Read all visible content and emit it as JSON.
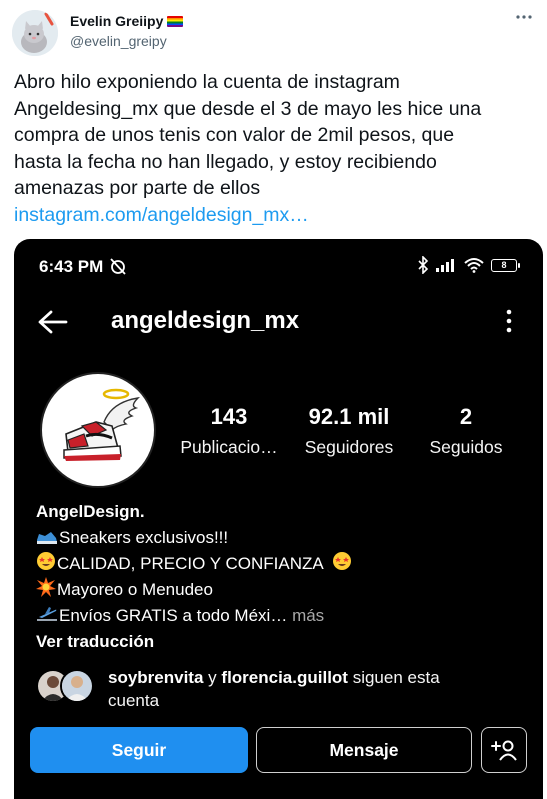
{
  "tweet": {
    "author_name": "Evelin Greiipy",
    "author_handle": "@evelin_greipy",
    "more_icon": "more-horizontal-icon",
    "text_lines": [
      "Abro hilo exponiendo la cuenta de instagram",
      "Angeldesing_mx que desde el 3 de mayo les hice una",
      "compra de unos tenis con valor de 2mil pesos, que",
      "hasta la fecha no han llegado, y estoy recibiendo",
      "amenazas por parte de ellos"
    ],
    "link_text": "instagram.com/angeldesign_mx…",
    "link_color": "#1d9bf0"
  },
  "instagram": {
    "status_bar": {
      "time": "6:43 PM",
      "battery": "8"
    },
    "username": "angeldesign_mx",
    "stats": [
      {
        "value": "143",
        "label": "Publicacio…"
      },
      {
        "value": "92.1 mil",
        "label": "Seguidores"
      },
      {
        "value": "2",
        "label": "Seguidos"
      }
    ],
    "bio": {
      "name": "AngelDesign.",
      "line1": "Sneakers exclusivos!!!",
      "line2": "CALIDAD, PRECIO Y CONFIANZA",
      "line3": "Mayoreo o Menudeo",
      "line4": "Envíos GRATIS a todo Méxi…",
      "more": "más",
      "translate": "Ver traducción"
    },
    "followed_by": {
      "user1": "soybrenvita",
      "connector": "y",
      "user2": "florencia.guillot",
      "suffix": "siguen esta",
      "suffix2": "cuenta"
    },
    "buttons": {
      "follow": "Seguir",
      "message": "Mensaje",
      "add_icon": "add-person-icon"
    },
    "colors": {
      "follow_button": "#1f8ff0",
      "background": "#000000"
    }
  }
}
